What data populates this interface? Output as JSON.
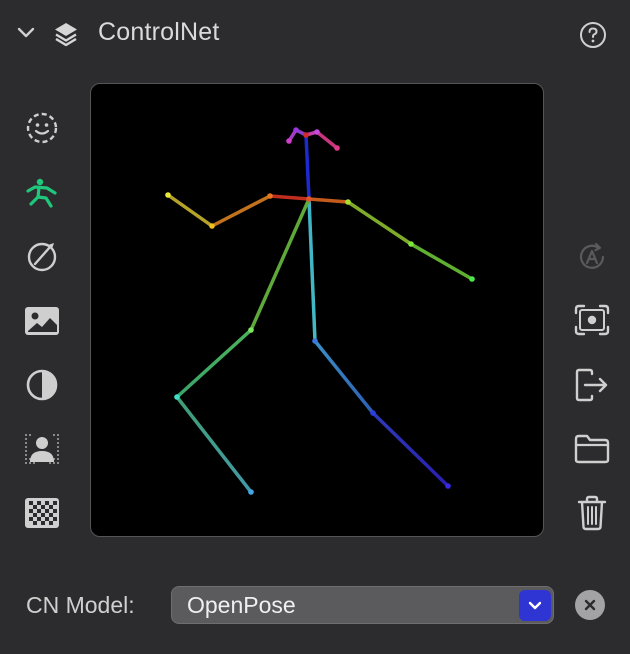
{
  "header": {
    "title": "ControlNet",
    "collapse_icon": "chevron-down-icon",
    "layers_icon": "layers-icon",
    "help_icon": "help-circle-icon"
  },
  "left_toolbar": [
    {
      "icon": "face-dashed-icon",
      "active": false
    },
    {
      "icon": "pose-figure-icon",
      "active": true
    },
    {
      "icon": "scribble-circle-icon",
      "active": false
    },
    {
      "icon": "image-icon",
      "active": false
    },
    {
      "icon": "contrast-icon",
      "active": false
    },
    {
      "icon": "person-depth-icon",
      "active": false
    },
    {
      "icon": "checkerboard-icon",
      "active": false
    }
  ],
  "right_toolbar": [
    {
      "icon": "auto-annotate-icon",
      "enabled": false
    },
    {
      "icon": "capture-frame-icon",
      "enabled": true
    },
    {
      "icon": "export-icon",
      "enabled": true
    },
    {
      "icon": "folder-icon",
      "enabled": true
    },
    {
      "icon": "trash-icon",
      "enabled": true
    }
  ],
  "footer": {
    "cn_model_label": "CN Model:",
    "cn_model_value": "OpenPose"
  },
  "colors": {
    "accent": "#2f35d3",
    "active_icon": "#1fc77a",
    "background": "#2c2c2e"
  }
}
